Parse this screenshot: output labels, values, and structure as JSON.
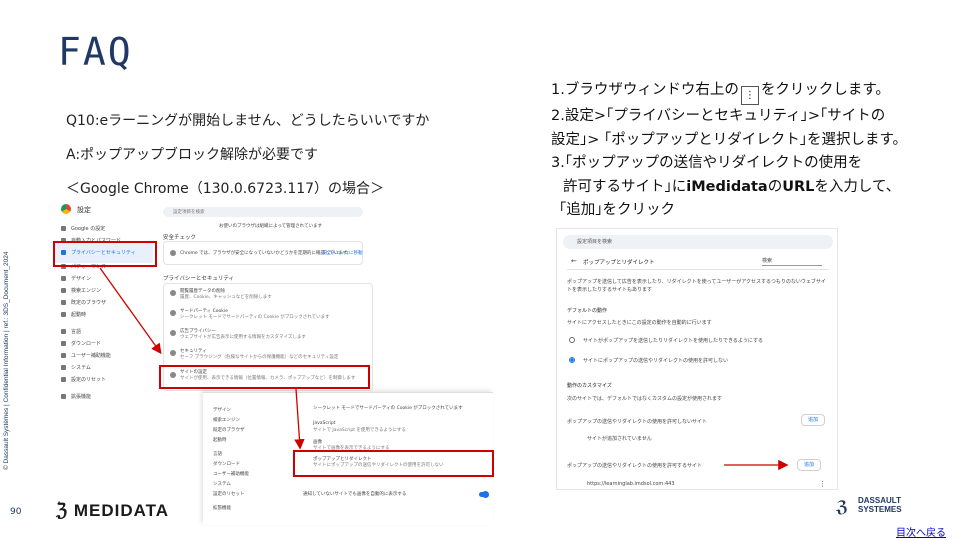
{
  "title": "FAQ",
  "side_text": "© Dassault Systèmes | Confidential Information | ref.: 3DS_Document_2024",
  "question": "Q10:eラーニングが開始しません、どうしたらいいですか",
  "answer": "A:ポップアップブロック解除が必要です",
  "browser_note": "＜Google Chrome（130.0.6723.117）の場合＞",
  "steps": {
    "s1_pre": "1.ブラウザウィンドウ右上の",
    "s1_icon": "⋮",
    "s1_post": "をクリックします。",
    "s2_line1": "2.設定>｢プライバシーとセキュリティ｣>｢サイトの",
    "s2_line2": "設定｣>  ｢ポップアップとリダイレクト｣を選択します。",
    "s3_line1": "3.｢ポップアップの送信やリダイレクトの使用を",
    "s3_line2_pre": "許可するサイト｣に",
    "s3_line2_bold": "iMedidata",
    "s3_line2_mid": "の",
    "s3_line2_bold2": "URL",
    "s3_line2_post": "を入力して、",
    "s3_line3": "｢追加｣をクリック"
  },
  "left_shot": {
    "header": "設定",
    "search": "設定項目を検索",
    "nav": [
      "Google の設定",
      "自動入力とパスワード",
      "プライバシーとセキュリティ",
      "パフォーマンス",
      "デザイン",
      "検索エンジン",
      "既定のブラウザ",
      "起動時",
      "言語",
      "ダウンロード",
      "ユーザー補助機能",
      "システム",
      "設定のリセット",
      "拡張機能"
    ],
    "managed": "お使いのブラウザは組織によって管理されています",
    "safety_head": "安全チェック",
    "safety_text": "Chrome では、ブラウザが安全になっていないかどうかを定期的に確認しています。",
    "safety_btn": "安全チェックに移動",
    "privacy_head": "プライバシーとセキュリティ",
    "rows": [
      {
        "title": "閲覧履歴データの削除",
        "sub": "履歴、Cookie、キャッシュなどを削除します"
      },
      {
        "title": "サードパーティ Cookie",
        "sub": "シークレット モードでサードパーティの Cookie がブロックされています"
      },
      {
        "title": "広告プライバシー",
        "sub": "ウェブサイトが広告表示に使用する情報をカスタマイズします"
      },
      {
        "title": "セキュリティ",
        "sub": "セーフ ブラウジング（危険なサイトからの保護機能）などのセキュリティ設定"
      },
      {
        "title": "サイトの設定",
        "sub": "サイトが使用、表示できる情報（位置情報、カメラ、ポップアップなど）を制御します"
      }
    ],
    "overlay_rows": [
      {
        "title": "サードパーティ Cookie",
        "sub": "シークレット モードでサードパーティの Cookie がブロックされています"
      },
      {
        "title": "JavaScript",
        "sub": "サイトで JavaScript を使用できるようにする"
      },
      {
        "title": "画像",
        "sub": "サイトで画像を表示できるようにする"
      },
      {
        "title": "ポップアップとリダイレクト",
        "sub": "サイトにポップアップの送信やリダイレクトの使用を許可しない"
      }
    ],
    "overlay_bottom": "通知していないサイトでも画像を自動的に表示する"
  },
  "right_shot": {
    "search": "設定項目を検索",
    "header": "ポップアップとリダイレクト",
    "search_small": "検索",
    "desc": "ポップアップを送信して広告を表示したり、リダイレクトを使ってユーザーがアクセスするつもりのないウェブサイトを表示したりするサイトもあります",
    "default_head": "デフォルトの動作",
    "default_sub": "サイトにアクセスしたときにこの設定の動作を自動的に行います",
    "opt1": "サイトがポップアップを送信したりリダイレクトを使用したりできるようにする",
    "opt2": "サイトにポップアップの送信やリダイレクトの使用を許可しない",
    "custom_head": "動作のカスタマイズ",
    "custom_sub": "次のサイトでは、デフォルトではなくカスタムの設定が使用されます",
    "block_head": "ポップアップの送信やリダイレクトの使用を許可しないサイト",
    "add_label": "追加",
    "no_sites": "サイトが追加されていません",
    "allow_head": "ポップアップの送信やリダイレクトの使用を許可するサイト",
    "url": "https://learninglab.imdsol.com:443"
  },
  "page_number": "90",
  "medidata_logo": "MEDIDATA",
  "ds_logo_line1": "DASSAULT",
  "ds_logo_line2": "SYSTEMES",
  "back_link": "目次へ戻る",
  "colors": {
    "title": "#1f3864",
    "accent_red": "#d00000",
    "chrome_blue": "#1a73e8"
  }
}
